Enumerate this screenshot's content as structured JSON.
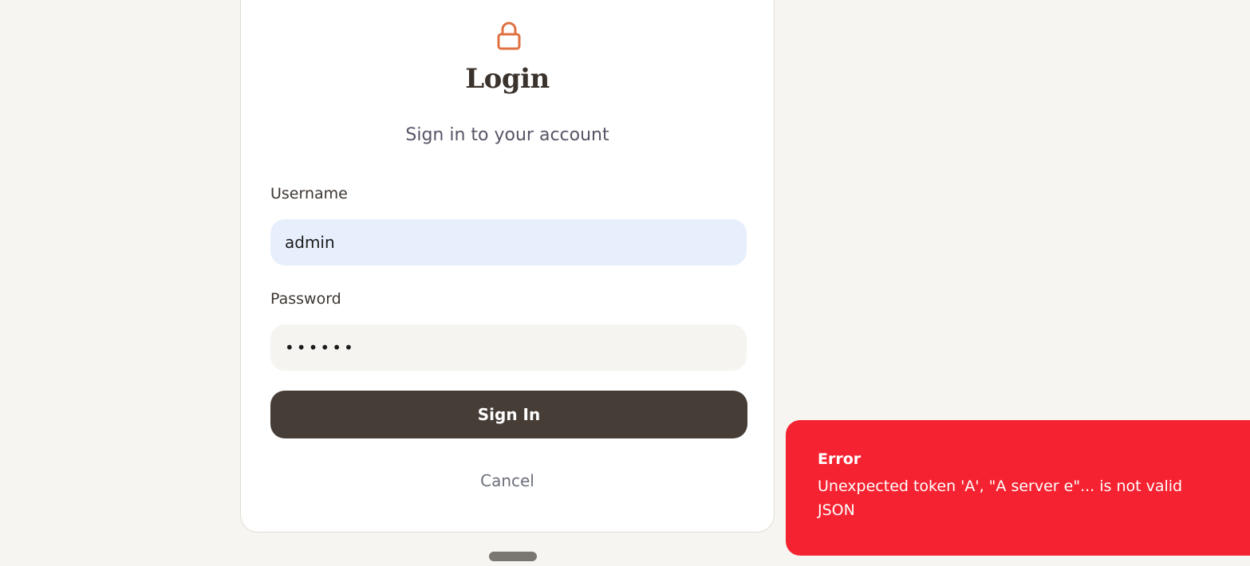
{
  "login": {
    "title": "Login",
    "subtitle": "Sign in to your account",
    "username_label": "Username",
    "username_value": "admin",
    "password_label": "Password",
    "password_value": "••••••",
    "signin_label": "Sign In",
    "cancel_label": "Cancel"
  },
  "toast": {
    "title": "Error",
    "message": "Unexpected token 'A', \"A server e\"... is not valid JSON"
  },
  "colors": {
    "accent": "#e07040",
    "button": "#463d37",
    "error": "#f52331"
  },
  "icons": {
    "lock": "lock-icon"
  }
}
